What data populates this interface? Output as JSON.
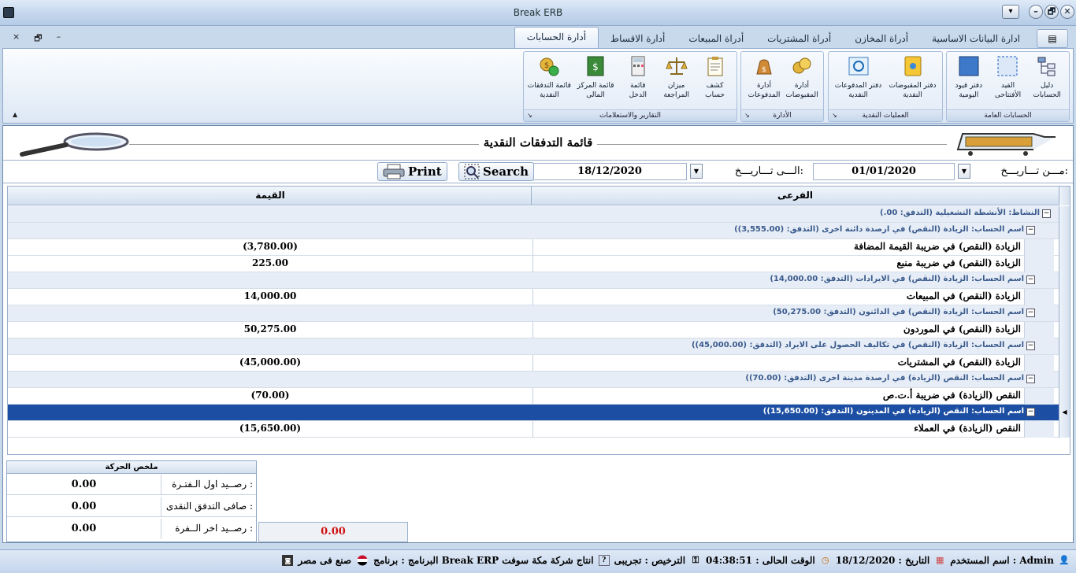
{
  "window": {
    "title": "Break ERB"
  },
  "mdi_controls": [
    "×",
    "🗗",
    "–"
  ],
  "tabs": [
    {
      "label": "ادارة البيانات الاساسية",
      "active": false
    },
    {
      "label": "أدراة المخازن",
      "active": false
    },
    {
      "label": "أدراة المشتريات",
      "active": false
    },
    {
      "label": "أدراة المبيعات",
      "active": false
    },
    {
      "label": "أدارة الاقساط",
      "active": false
    },
    {
      "label": "أدارة الحسابات",
      "active": true
    }
  ],
  "ribbon": {
    "groups": [
      {
        "label": "الحسابات العامة",
        "buttons": [
          {
            "label": "دليل الحسابات",
            "icon": "tree-icon"
          },
          {
            "label": "القيد\nالأفتتاحى",
            "icon": "entry-icon"
          },
          {
            "label": "دفتر قيود\nاليومية",
            "icon": "journal-icon"
          }
        ]
      },
      {
        "label": "العمليات النقدية",
        "buttons": [
          {
            "label": "دفتر المقبوضات\nالنقدية",
            "icon": "receipts-icon"
          },
          {
            "label": "دفتر المدفوعات\nالنقدية",
            "icon": "payments-icon"
          }
        ]
      },
      {
        "label": "الأدارة",
        "buttons": [
          {
            "label": "أدارة\nالمقبوضات",
            "icon": "coins-icon"
          },
          {
            "label": "أدارة\nالمدفوعات",
            "icon": "money-bag-icon"
          }
        ]
      },
      {
        "label": "التقارير والاستعلامات",
        "buttons": [
          {
            "label": "كشف حساب",
            "icon": "clipboard-icon"
          },
          {
            "label": "ميزان\nالمراجعة",
            "icon": "scale-icon"
          },
          {
            "label": "قائمة\nالدخل",
            "icon": "calculator-icon"
          },
          {
            "label": "قائمة المركز\nالمالى",
            "icon": "ledger-icon"
          },
          {
            "label": "قائمة التدفقات\nالنقدية",
            "icon": "cashflow-icon"
          }
        ]
      }
    ]
  },
  "form": {
    "title": "قائمة التدفقات النقدية",
    "from_label": "مـــن تـــاريـــخ:",
    "from_date": "01/01/2020",
    "to_label": "الـــى تـــاريـــخ:",
    "to_date": "18/12/2020",
    "search_label": "Search",
    "print_label": "Print"
  },
  "grid": {
    "columns": {
      "branch": "الفرعى",
      "value": "القيمة"
    },
    "rows": [
      {
        "type": "group",
        "level": 0,
        "text": "النشاط: الأنشطة التشغيلية (التدفق: 00.)"
      },
      {
        "type": "group",
        "level": 1,
        "text": "اسم الحساب: الزيادة (النقص) في ارصدة دائنة اخرى (التدفق: (3,555.00))"
      },
      {
        "type": "data",
        "branch": "الزيادة (النقص) في ضريبة القيمة المضافة",
        "value": "(3,780.00)"
      },
      {
        "type": "data",
        "branch": "الزيادة (النقص) في ضريبة منبع",
        "value": "225.00"
      },
      {
        "type": "group",
        "level": 1,
        "text": "اسم الحساب: الزيادة (النقص) في الايرادات (التدفق: 14,000.00)"
      },
      {
        "type": "data",
        "branch": "الزيادة (النقص) في المبيعات",
        "value": "14,000.00"
      },
      {
        "type": "group",
        "level": 1,
        "text": "اسم الحساب: الزيادة (النقص) في الدائنون (التدفق: 50,275.00)"
      },
      {
        "type": "data",
        "branch": "الزيادة (النقص) في الموردون",
        "value": "50,275.00"
      },
      {
        "type": "group",
        "level": 1,
        "text": "اسم الحساب: الزيادة (النقص) في تكاليف الحصول على الايراد (التدفق: (45,000.00))"
      },
      {
        "type": "data",
        "branch": "الزيادة (النقص) في المشتريات",
        "value": "(45,000.00)"
      },
      {
        "type": "group",
        "level": 1,
        "text": "اسم الحساب: النقص (الزيادة) في ارصدة مدينة اخرى (التدفق: (70.00))"
      },
      {
        "type": "data",
        "branch": "النقص (الزيادة) في ضريبة أ.ت.ص",
        "value": "(70.00)"
      },
      {
        "type": "group",
        "level": 1,
        "text": "اسم الحساب: النقص (الزيادة) في المدينون (التدفق: (15,650.00))",
        "selected": true
      },
      {
        "type": "data",
        "branch": "النقص (الزيادة) في العملاء",
        "value": "(15,650.00)"
      }
    ]
  },
  "summary": {
    "title": "ملخص الحركة",
    "rows": [
      {
        "label": "رصــيد اول الـفتـرة :",
        "value": "0.00"
      },
      {
        "label": "صافى التدفق النقدى :",
        "value": "0.00"
      },
      {
        "label": "رصــيد اخر الــفرة :",
        "value": "0.00"
      }
    ],
    "extra_total": "0.00"
  },
  "status": {
    "user": "اسم المستخدم : Admin",
    "date": "التاريخ : 18/12/2020",
    "time": "الوقت الحالى : 04:38:51",
    "license": "الترخيص : تجريبى",
    "program": "البرنامج : برنامج Break ERP انتاج شركة مكة سوفت",
    "made_in": "صنع فى مصر"
  },
  "colors": {
    "accent": "#1c4fa3",
    "negative_total": "#d01010",
    "group_text": "#3a5a8c"
  }
}
